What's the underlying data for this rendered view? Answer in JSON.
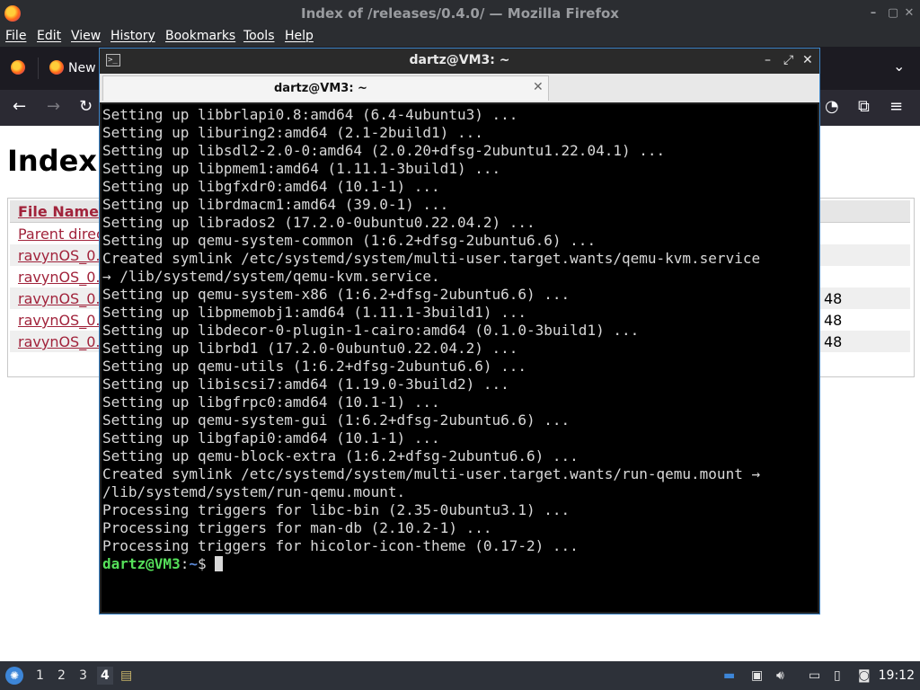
{
  "firefox": {
    "window_title": "Index of /releases/0.4.0/ — Mozilla Firefox",
    "menu": [
      "File",
      "Edit",
      "View",
      "History",
      "Bookmarks",
      "Tools",
      "Help"
    ],
    "tab_label": "New",
    "page_heading": "Index",
    "listing": {
      "header": "File Name",
      "rows": [
        {
          "name": "Parent direc",
          "size": ""
        },
        {
          "name": "ravynOS_0.",
          "size": ""
        },
        {
          "name": "ravynOS_0.",
          "size": ""
        },
        {
          "name": "ravynOS_0.",
          "size": "48"
        },
        {
          "name": "ravynOS_0.",
          "size": "48"
        },
        {
          "name": "ravynOS_0.",
          "size": "48"
        }
      ]
    }
  },
  "terminal": {
    "window_title": "dartz@VM3: ~",
    "tab_label": "dartz@VM3: ~",
    "lines": [
      "Setting up libbrlapi0.8:amd64 (6.4-4ubuntu3) ...",
      "Setting up liburing2:amd64 (2.1-2build1) ...",
      "Setting up libsdl2-2.0-0:amd64 (2.0.20+dfsg-2ubuntu1.22.04.1) ...",
      "Setting up libpmem1:amd64 (1.11.1-3build1) ...",
      "Setting up libgfxdr0:amd64 (10.1-1) ...",
      "Setting up librdmacm1:amd64 (39.0-1) ...",
      "Setting up librados2 (17.2.0-0ubuntu0.22.04.2) ...",
      "Setting up qemu-system-common (1:6.2+dfsg-2ubuntu6.6) ...",
      "Created symlink /etc/systemd/system/multi-user.target.wants/qemu-kvm.service",
      "→ /lib/systemd/system/qemu-kvm.service.",
      "Setting up qemu-system-x86 (1:6.2+dfsg-2ubuntu6.6) ...",
      "Setting up libpmemobj1:amd64 (1.11.1-3build1) ...",
      "Setting up libdecor-0-plugin-1-cairo:amd64 (0.1.0-3build1) ...",
      "Setting up librbd1 (17.2.0-0ubuntu0.22.04.2) ...",
      "Setting up qemu-utils (1:6.2+dfsg-2ubuntu6.6) ...",
      "Setting up libiscsi7:amd64 (1.19.0-3build2) ...",
      "Setting up libgfrpc0:amd64 (10.1-1) ...",
      "Setting up qemu-system-gui (1:6.2+dfsg-2ubuntu6.6) ...",
      "Setting up libgfapi0:amd64 (10.1-1) ...",
      "Setting up qemu-block-extra (1:6.2+dfsg-2ubuntu6.6) ...",
      "Created symlink /etc/systemd/system/multi-user.target.wants/run-qemu.mount →",
      "/lib/systemd/system/run-qemu.mount.",
      "Processing triggers for libc-bin (2.35-0ubuntu3.1) ...",
      "Processing triggers for man-db (2.10.2-1) ...",
      "Processing triggers for hicolor-icon-theme (0.17-2) ..."
    ],
    "prompt_user": "dartz@VM3",
    "prompt_sep": ":",
    "prompt_path": "~",
    "prompt_symbol": "$ "
  },
  "taskbar": {
    "workspaces": [
      "1",
      "2",
      "3",
      "4"
    ],
    "active_workspace": "4",
    "clock": "19:12"
  }
}
